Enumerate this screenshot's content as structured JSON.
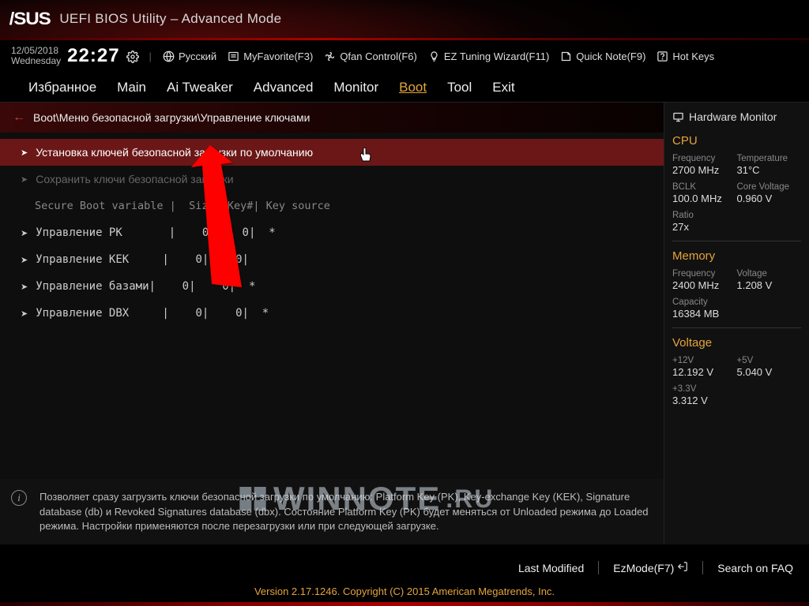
{
  "header": {
    "brand": "/SUS",
    "title": "UEFI BIOS Utility – Advanced Mode"
  },
  "datetime": {
    "date": "12/05/2018",
    "day": "Wednesday",
    "time": "22:27"
  },
  "toolbar": {
    "language": "Русский",
    "favorite": "MyFavorite(F3)",
    "qfan": "Qfan Control(F6)",
    "tuning": "EZ Tuning Wizard(F11)",
    "quicknote": "Quick Note(F9)",
    "hotkeys": "Hot Keys"
  },
  "tabs": [
    "Избранное",
    "Main",
    "Ai Tweaker",
    "Advanced",
    "Monitor",
    "Boot",
    "Tool",
    "Exit"
  ],
  "active_tab": "Boot",
  "breadcrumb": "Boot\\Меню безопасной загрузки\\Управление ключами",
  "rows": {
    "r0": "Установка ключей безопасной загрузки по умолчанию",
    "r1": "Сохранить ключи безопасной загрузки",
    "header": "Secure Boot variable |  Size| Key#| Key source",
    "pk": "Управление PK       |    0|    0|  *",
    "kek": "Управление KEK     |    0|    0|",
    "db": "Управление базами|    0|    0|  *",
    "dbx": "Управление DBX     |    0|    0|  *"
  },
  "help_text": "Позволяет сразу загрузить ключи безопасной загрузки по умолчанию: Platform Key (PK), Key-exchange Key (KEK), Signature database (db) и Revoked Signatures database (dbx). Состояние Platform Key (PK) будет меняться от Unloaded режима до Loaded режима. Настройки применяются после перезагрузки или при следующей загрузке.",
  "hwmon": {
    "title": "Hardware Monitor",
    "cpu": {
      "heading": "CPU",
      "freq_l": "Frequency",
      "freq_v": "2700 MHz",
      "temp_l": "Temperature",
      "temp_v": "31°C",
      "bclk_l": "BCLK",
      "bclk_v": "100.0 MHz",
      "cv_l": "Core Voltage",
      "cv_v": "0.960 V",
      "ratio_l": "Ratio",
      "ratio_v": "27x"
    },
    "mem": {
      "heading": "Memory",
      "freq_l": "Frequency",
      "freq_v": "2400 MHz",
      "volt_l": "Voltage",
      "volt_v": "1.208 V",
      "cap_l": "Capacity",
      "cap_v": "16384 MB"
    },
    "volt": {
      "heading": "Voltage",
      "v12_l": "+12V",
      "v12_v": "12.192 V",
      "v5_l": "+5V",
      "v5_v": "5.040 V",
      "v33_l": "+3.3V",
      "v33_v": "3.312 V"
    }
  },
  "footer": {
    "last_modified": "Last Modified",
    "ezmode": "EzMode(F7)",
    "search": "Search on FAQ",
    "copyright": "Version 2.17.1246. Copyright (C) 2015 American Megatrends, Inc."
  }
}
